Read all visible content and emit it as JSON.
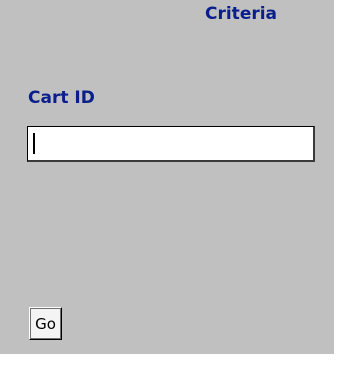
{
  "header": {
    "title": "Criteria"
  },
  "form": {
    "cart_id_label": "Cart ID",
    "cart_id_value": "",
    "go_label": "Go"
  },
  "colors": {
    "background": "#c0c0c0",
    "label_text": "#0a1e8c"
  }
}
